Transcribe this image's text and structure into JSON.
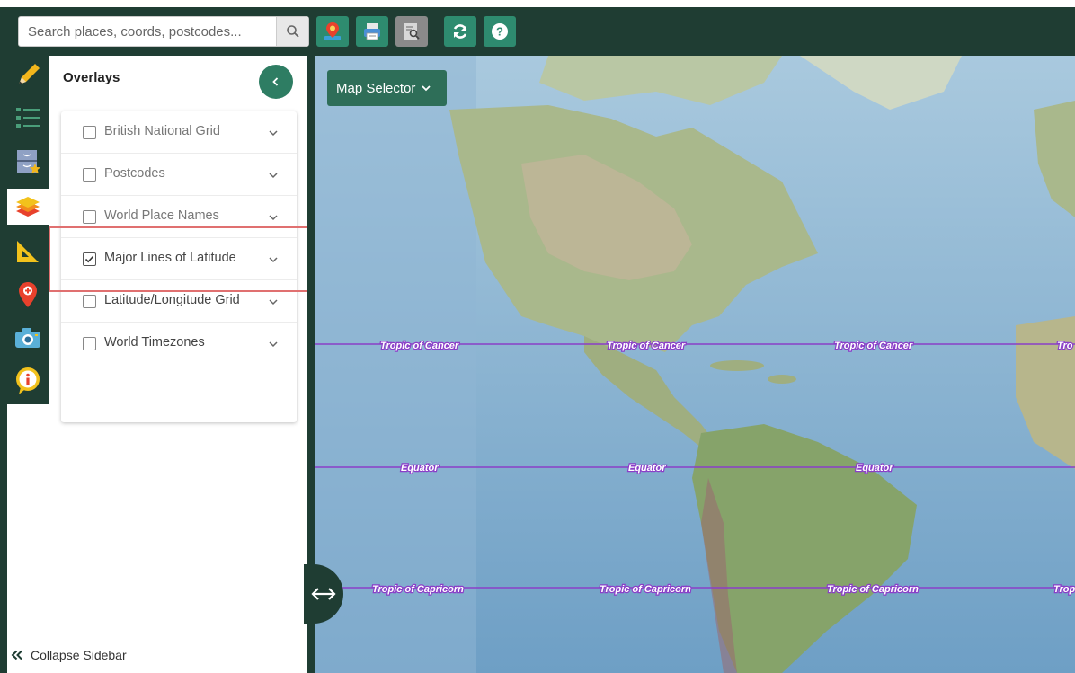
{
  "toolbar": {
    "search_placeholder": "Search places, coords, postcodes...",
    "buttons": [
      "add-marker",
      "print",
      "print-preview",
      "refresh",
      "help"
    ]
  },
  "rail": {
    "items": [
      "pencil-icon",
      "list-icon",
      "bookmarks-icon",
      "layers-icon",
      "ruler-icon",
      "marker-icon",
      "camera-icon",
      "info-icon"
    ],
    "active": "layers-icon"
  },
  "panel": {
    "title": "Overlays",
    "overlays": [
      {
        "label": "British National Grid",
        "checked": false
      },
      {
        "label": "Postcodes",
        "checked": false
      },
      {
        "label": "World Place Names",
        "checked": false
      },
      {
        "label": "Major Lines of Latitude",
        "checked": true
      },
      {
        "label": "Latitude/Longitude Grid",
        "checked": false
      },
      {
        "label": "World Timezones",
        "checked": false
      }
    ],
    "collapse_label": "Collapse Sidebar"
  },
  "map": {
    "selector_label": "Map Selector",
    "lines": [
      {
        "name": "Tropic of Cancer",
        "labels": [
          "Tropic of Cancer",
          "Tropic of Cancer",
          "Tropic of Cancer",
          "Tro"
        ]
      },
      {
        "name": "Equator",
        "labels": [
          "Equator",
          "Equator",
          "Equator"
        ]
      },
      {
        "name": "Tropic of Capricorn",
        "labels": [
          "Tropic of Capricorn",
          "Tropic of Capricorn",
          "Tropic of Capricorn",
          "Trop"
        ]
      }
    ],
    "line_color": "#8a3ec8"
  },
  "colors": {
    "dark_green": "#1f3d33",
    "accent_green": "#2e8b6f",
    "highlight": "#e07070"
  }
}
